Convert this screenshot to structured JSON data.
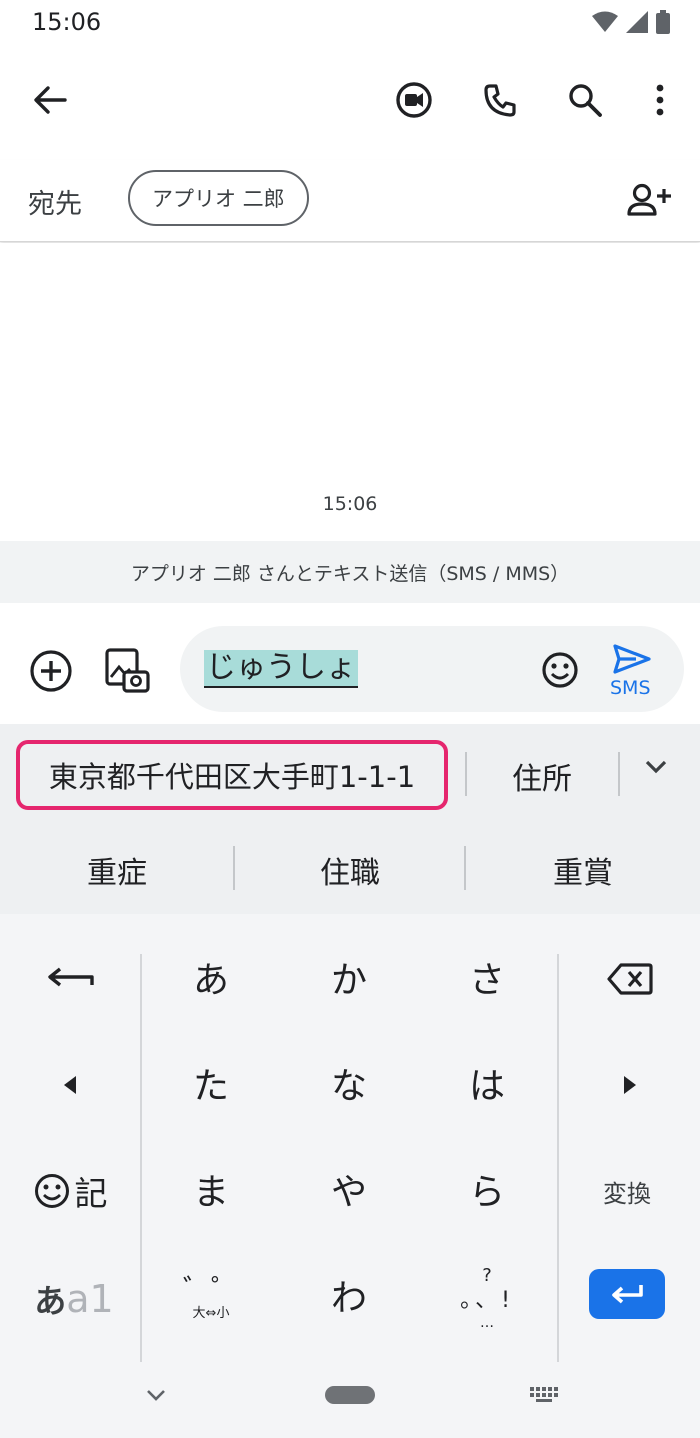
{
  "status_bar": {
    "time": "15:06"
  },
  "app_bar": {
    "back_icon": "arrow-left-icon",
    "actions": [
      "video-call-icon",
      "phone-icon",
      "search-icon",
      "more-vert-icon"
    ]
  },
  "recipients": {
    "label": "宛先",
    "chip": "アプリオ 二郎",
    "add_icon": "add-person-icon"
  },
  "conversation": {
    "timestamp": "15:06",
    "info": "アプリオ 二郎 さんとテキスト送信（SMS / MMS）"
  },
  "compose": {
    "text": "じゅうしょ",
    "send_label": "SMS"
  },
  "candidates": {
    "row1": [
      "東京都千代田区大手町1-1-1",
      "住所"
    ],
    "row2": [
      "重症",
      "住職",
      "重賞"
    ]
  },
  "keyboard": {
    "row1": [
      "あ",
      "か",
      "さ"
    ],
    "row2": [
      "た",
      "な",
      "は"
    ],
    "row3": [
      "ま",
      "や",
      "ら"
    ],
    "row4_center": "わ",
    "symbol_key": "記",
    "convert_key": "変換",
    "mode_key_a": "あ",
    "mode_key_b": "a1",
    "dakuten_top": "゛゜",
    "dakuten_bottom": "大⇔小",
    "punct_top": "?",
    "punct_middle": "。、!",
    "punct_bottom": "…"
  },
  "colors": {
    "accent": "#1a73e8",
    "highlight_border": "#e5266e",
    "composing_bg": "#a8dcd9"
  }
}
